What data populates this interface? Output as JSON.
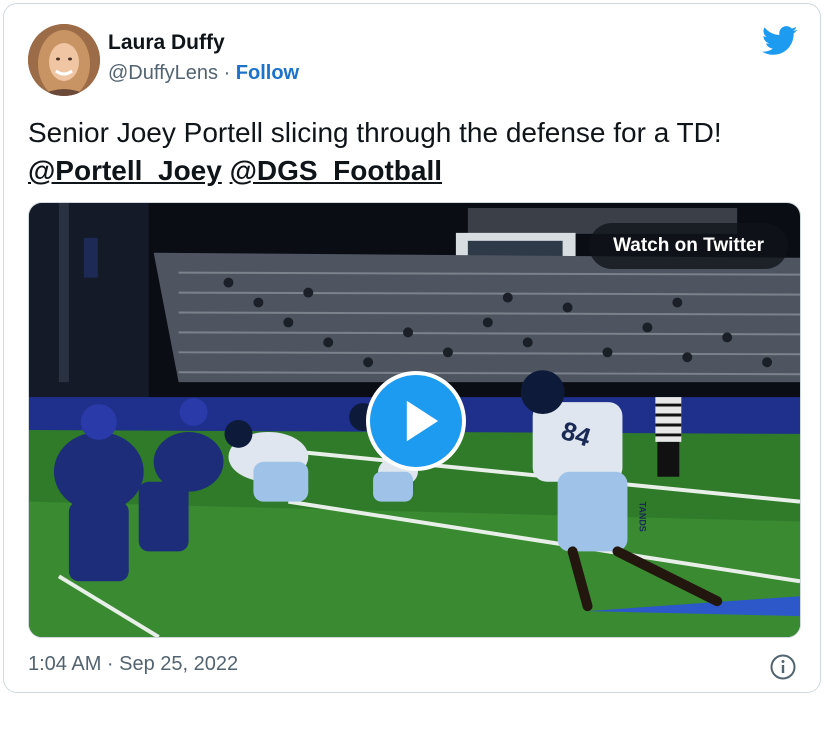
{
  "author": {
    "name": "Laura Duffy",
    "handle": "@DuffyLens",
    "separator": "·",
    "follow_label": "Follow",
    "avatar_icon": "profile-photo"
  },
  "tweet": {
    "text": "Senior Joey Portell slicing through the defense for a TD!",
    "mentions": [
      "@Portell_Joey",
      "@DGS_Football"
    ]
  },
  "media": {
    "watch_label": "Watch on Twitter",
    "play_icon": "play-icon",
    "jersey_number": "84",
    "pants_text": "TANDS"
  },
  "footer": {
    "timestamp": "1:04 AM · Sep 25, 2022",
    "info_icon": "info-icon"
  },
  "colors": {
    "accent": "#1d9bf0",
    "follow": "#1d73c9",
    "text": "#0f1419",
    "muted": "#536471"
  }
}
